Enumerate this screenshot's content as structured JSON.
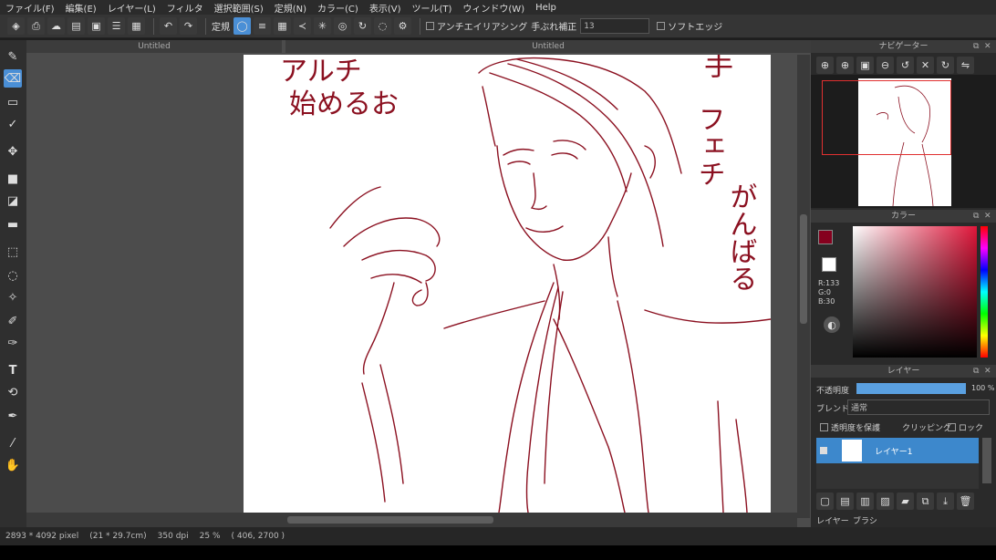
{
  "menu": [
    "ファイル(F)",
    "編集(E)",
    "レイヤー(L)",
    "フィルタ",
    "選択範囲(S)",
    "定規(N)",
    "カラー(C)",
    "表示(V)",
    "ツール(T)",
    "ウィンドウ(W)",
    "Help"
  ],
  "toolbar": {
    "ruler_label": "定規",
    "antialias_label": "アンチエイリアシング",
    "stabilizer_label": "手ぶれ補正",
    "stabilizer_value": "13",
    "soft_edge_label": "ソフトエッジ"
  },
  "tabs": {
    "left_title": "Untitled",
    "canvas_title": "Untitled"
  },
  "navigator": {
    "title": "ナビゲーター"
  },
  "color": {
    "title": "カラー",
    "r": "R:133",
    "g": "G:0",
    "b": "B:30",
    "primary": "#85001e",
    "secondary": "#ffffff"
  },
  "layers": {
    "title": "レイヤー",
    "opacity_label": "不透明度",
    "opacity_value": "100 %",
    "opacity_fraction": 1.0,
    "blend_label": "ブレンド",
    "blend_value": "通常",
    "preserve_label": "透明度を保護",
    "clipping_label": "クリッピング",
    "lock_label": "ロック",
    "layer_name": "レイヤー1"
  },
  "bottom_tabs": {
    "layers": "レイヤー",
    "brush": "ブラシ"
  },
  "status": {
    "size": "2893 * 4092 pixel",
    "cm": "(21 * 29.7cm)",
    "dpi": "350 dpi",
    "zoom": "25 %",
    "coords": "( 406, 2700 )"
  },
  "drawing": {
    "left_text_top": "アルチ",
    "left_text": "始めるお",
    "right_text_1": "手",
    "right_text_2": "フェチ",
    "right_text_3": "がんばる",
    "ink_color": "#8b1020"
  }
}
